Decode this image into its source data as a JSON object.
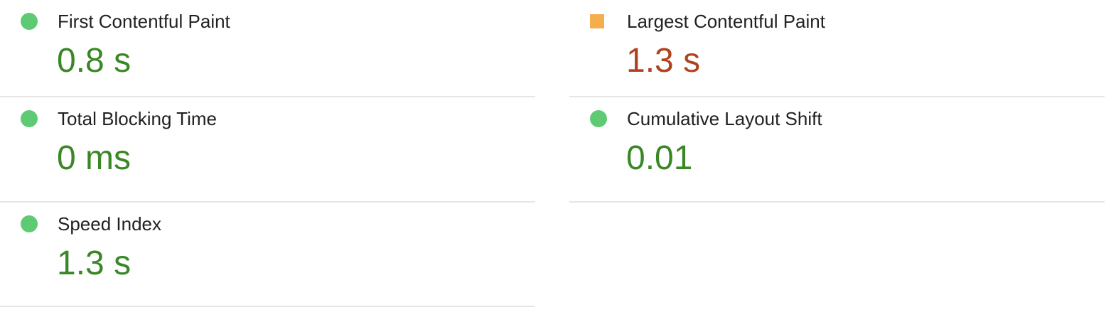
{
  "colors": {
    "pass_indicator": "#5ecb74",
    "average_indicator": "#f4ae4b",
    "pass_value": "#398725",
    "average_value": "#b0431f",
    "divider": "#e6e6e6"
  },
  "metrics": {
    "fcp": {
      "label": "First Contentful Paint",
      "value": "0.8 s",
      "status": "pass",
      "icon": "circle-icon"
    },
    "lcp": {
      "label": "Largest Contentful Paint",
      "value": "1.3 s",
      "status": "average",
      "icon": "square-icon"
    },
    "tbt": {
      "label": "Total Blocking Time",
      "value": "0 ms",
      "status": "pass",
      "icon": "circle-icon"
    },
    "cls": {
      "label": "Cumulative Layout Shift",
      "value": "0.01",
      "status": "pass",
      "icon": "circle-icon"
    },
    "si": {
      "label": "Speed Index",
      "value": "1.3 s",
      "status": "pass",
      "icon": "circle-icon"
    }
  }
}
